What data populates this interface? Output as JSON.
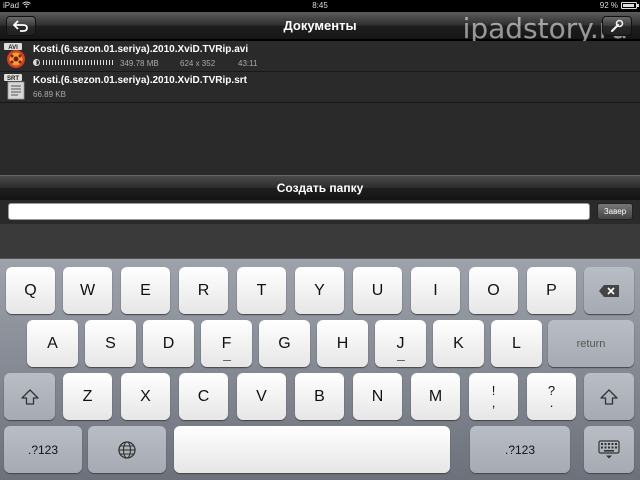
{
  "status": {
    "device": "iPad",
    "time": "8:45",
    "battery": "92 %"
  },
  "nav": {
    "title": "Документы",
    "watermark": "ipadstory.ru"
  },
  "files": [
    {
      "icon": "avi-file-icon",
      "badge": "AVI",
      "name": "Kosti.(6.sezon.01.seriya).2010.XviD.TVRip.avi",
      "size": "349.78 MB",
      "resolution": "624 x 352",
      "duration": "43:11"
    },
    {
      "icon": "srt-file-icon",
      "badge": "SRT",
      "name": "Kosti.(6.sezon.01.seriya).2010.XviD.TVRip.srt",
      "size": "66.89 KB"
    }
  ],
  "folder": {
    "title": "Создать папку",
    "input_value": "",
    "done_label": "Завер"
  },
  "keyboard": {
    "row1": [
      "Q",
      "W",
      "E",
      "R",
      "T",
      "Y",
      "U",
      "I",
      "O",
      "P"
    ],
    "row2": [
      "A",
      "S",
      "D",
      "F",
      "G",
      "H",
      "J",
      "K",
      "L"
    ],
    "row3": [
      "Z",
      "X",
      "C",
      "V",
      "B",
      "N",
      "M"
    ],
    "return_label": "return",
    "exclaim": [
      "!",
      ","
    ],
    "question": [
      "?",
      "."
    ],
    "numbers_label": ".?123"
  }
}
